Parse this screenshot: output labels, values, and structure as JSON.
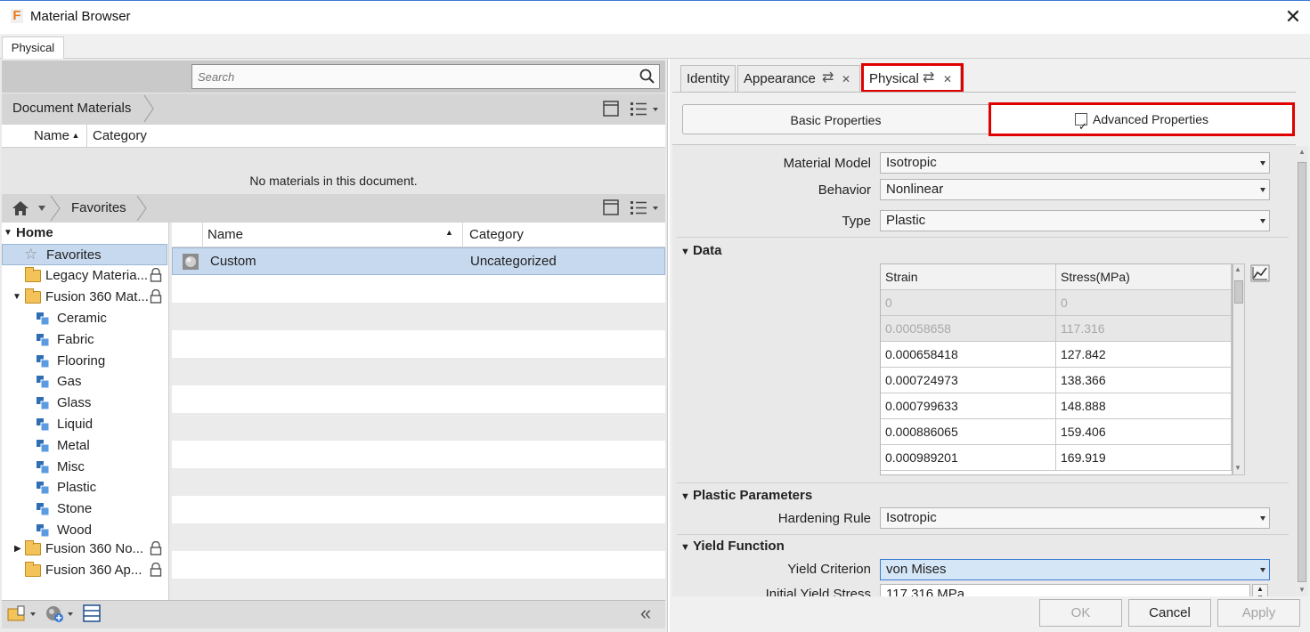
{
  "window": {
    "title": "Material Browser",
    "app_icon": "F",
    "close_glyph": "✕"
  },
  "top_tabs": [
    {
      "label": "Physical"
    }
  ],
  "search": {
    "placeholder": "Search"
  },
  "document_materials": {
    "breadcrumb": "Document Materials",
    "columns": {
      "name": "Name",
      "category": "Category"
    },
    "empty_message": "No materials in this document."
  },
  "library": {
    "breadcrumb": "Favorites",
    "tree": {
      "root": "Home",
      "favorites": "Favorites",
      "items": [
        {
          "label": "Legacy Materia..."
        },
        {
          "label": "Fusion 360 Mat..."
        },
        {
          "label": "Ceramic"
        },
        {
          "label": "Fabric"
        },
        {
          "label": "Flooring"
        },
        {
          "label": "Gas"
        },
        {
          "label": "Glass"
        },
        {
          "label": "Liquid"
        },
        {
          "label": "Metal"
        },
        {
          "label": "Misc"
        },
        {
          "label": "Plastic"
        },
        {
          "label": "Stone"
        },
        {
          "label": "Wood"
        },
        {
          "label": "Fusion 360 No..."
        },
        {
          "label": "Fusion 360 Ap..."
        }
      ]
    },
    "list": {
      "columns": {
        "name": "Name",
        "category": "Category"
      },
      "rows": [
        {
          "name": "Custom",
          "category": "Uncategorized"
        }
      ]
    }
  },
  "editor": {
    "tabs": {
      "identity": "Identity",
      "appearance": "Appearance",
      "physical": "Physical"
    },
    "toggle": {
      "basic": "Basic Properties",
      "advanced": "Advanced Properties"
    },
    "material_model": {
      "label": "Material Model",
      "value": "Isotropic"
    },
    "behavior": {
      "label": "Behavior",
      "value": "Nonlinear"
    },
    "type": {
      "label": "Type",
      "value": "Plastic"
    },
    "data_section": "Data",
    "data_table": {
      "columns": {
        "strain": "Strain",
        "stress": "Stress(MPa)"
      },
      "rows": [
        {
          "strain": "0",
          "stress": "0"
        },
        {
          "strain": "0.00058658",
          "stress": "117.316"
        },
        {
          "strain": "0.000658418",
          "stress": "127.842"
        },
        {
          "strain": "0.000724973",
          "stress": "138.366"
        },
        {
          "strain": "0.000799633",
          "stress": "148.888"
        },
        {
          "strain": "0.000886065",
          "stress": "159.406"
        },
        {
          "strain": "0.000989201",
          "stress": "169.919"
        }
      ]
    },
    "plastic_section": "Plastic Parameters",
    "hardening_rule": {
      "label": "Hardening Rule",
      "value": "Isotropic"
    },
    "yield_section": "Yield Function",
    "yield_criterion": {
      "label": "Yield Criterion",
      "value": "von Mises"
    },
    "initial_yield_stress": {
      "label": "Initial Yield Stress",
      "value": "117.316 MPa"
    }
  },
  "buttons": {
    "ok": "OK",
    "cancel": "Cancel",
    "apply": "Apply"
  },
  "colors": {
    "highlight_red": "#e00000",
    "selection_blue": "#c6d9ee"
  }
}
